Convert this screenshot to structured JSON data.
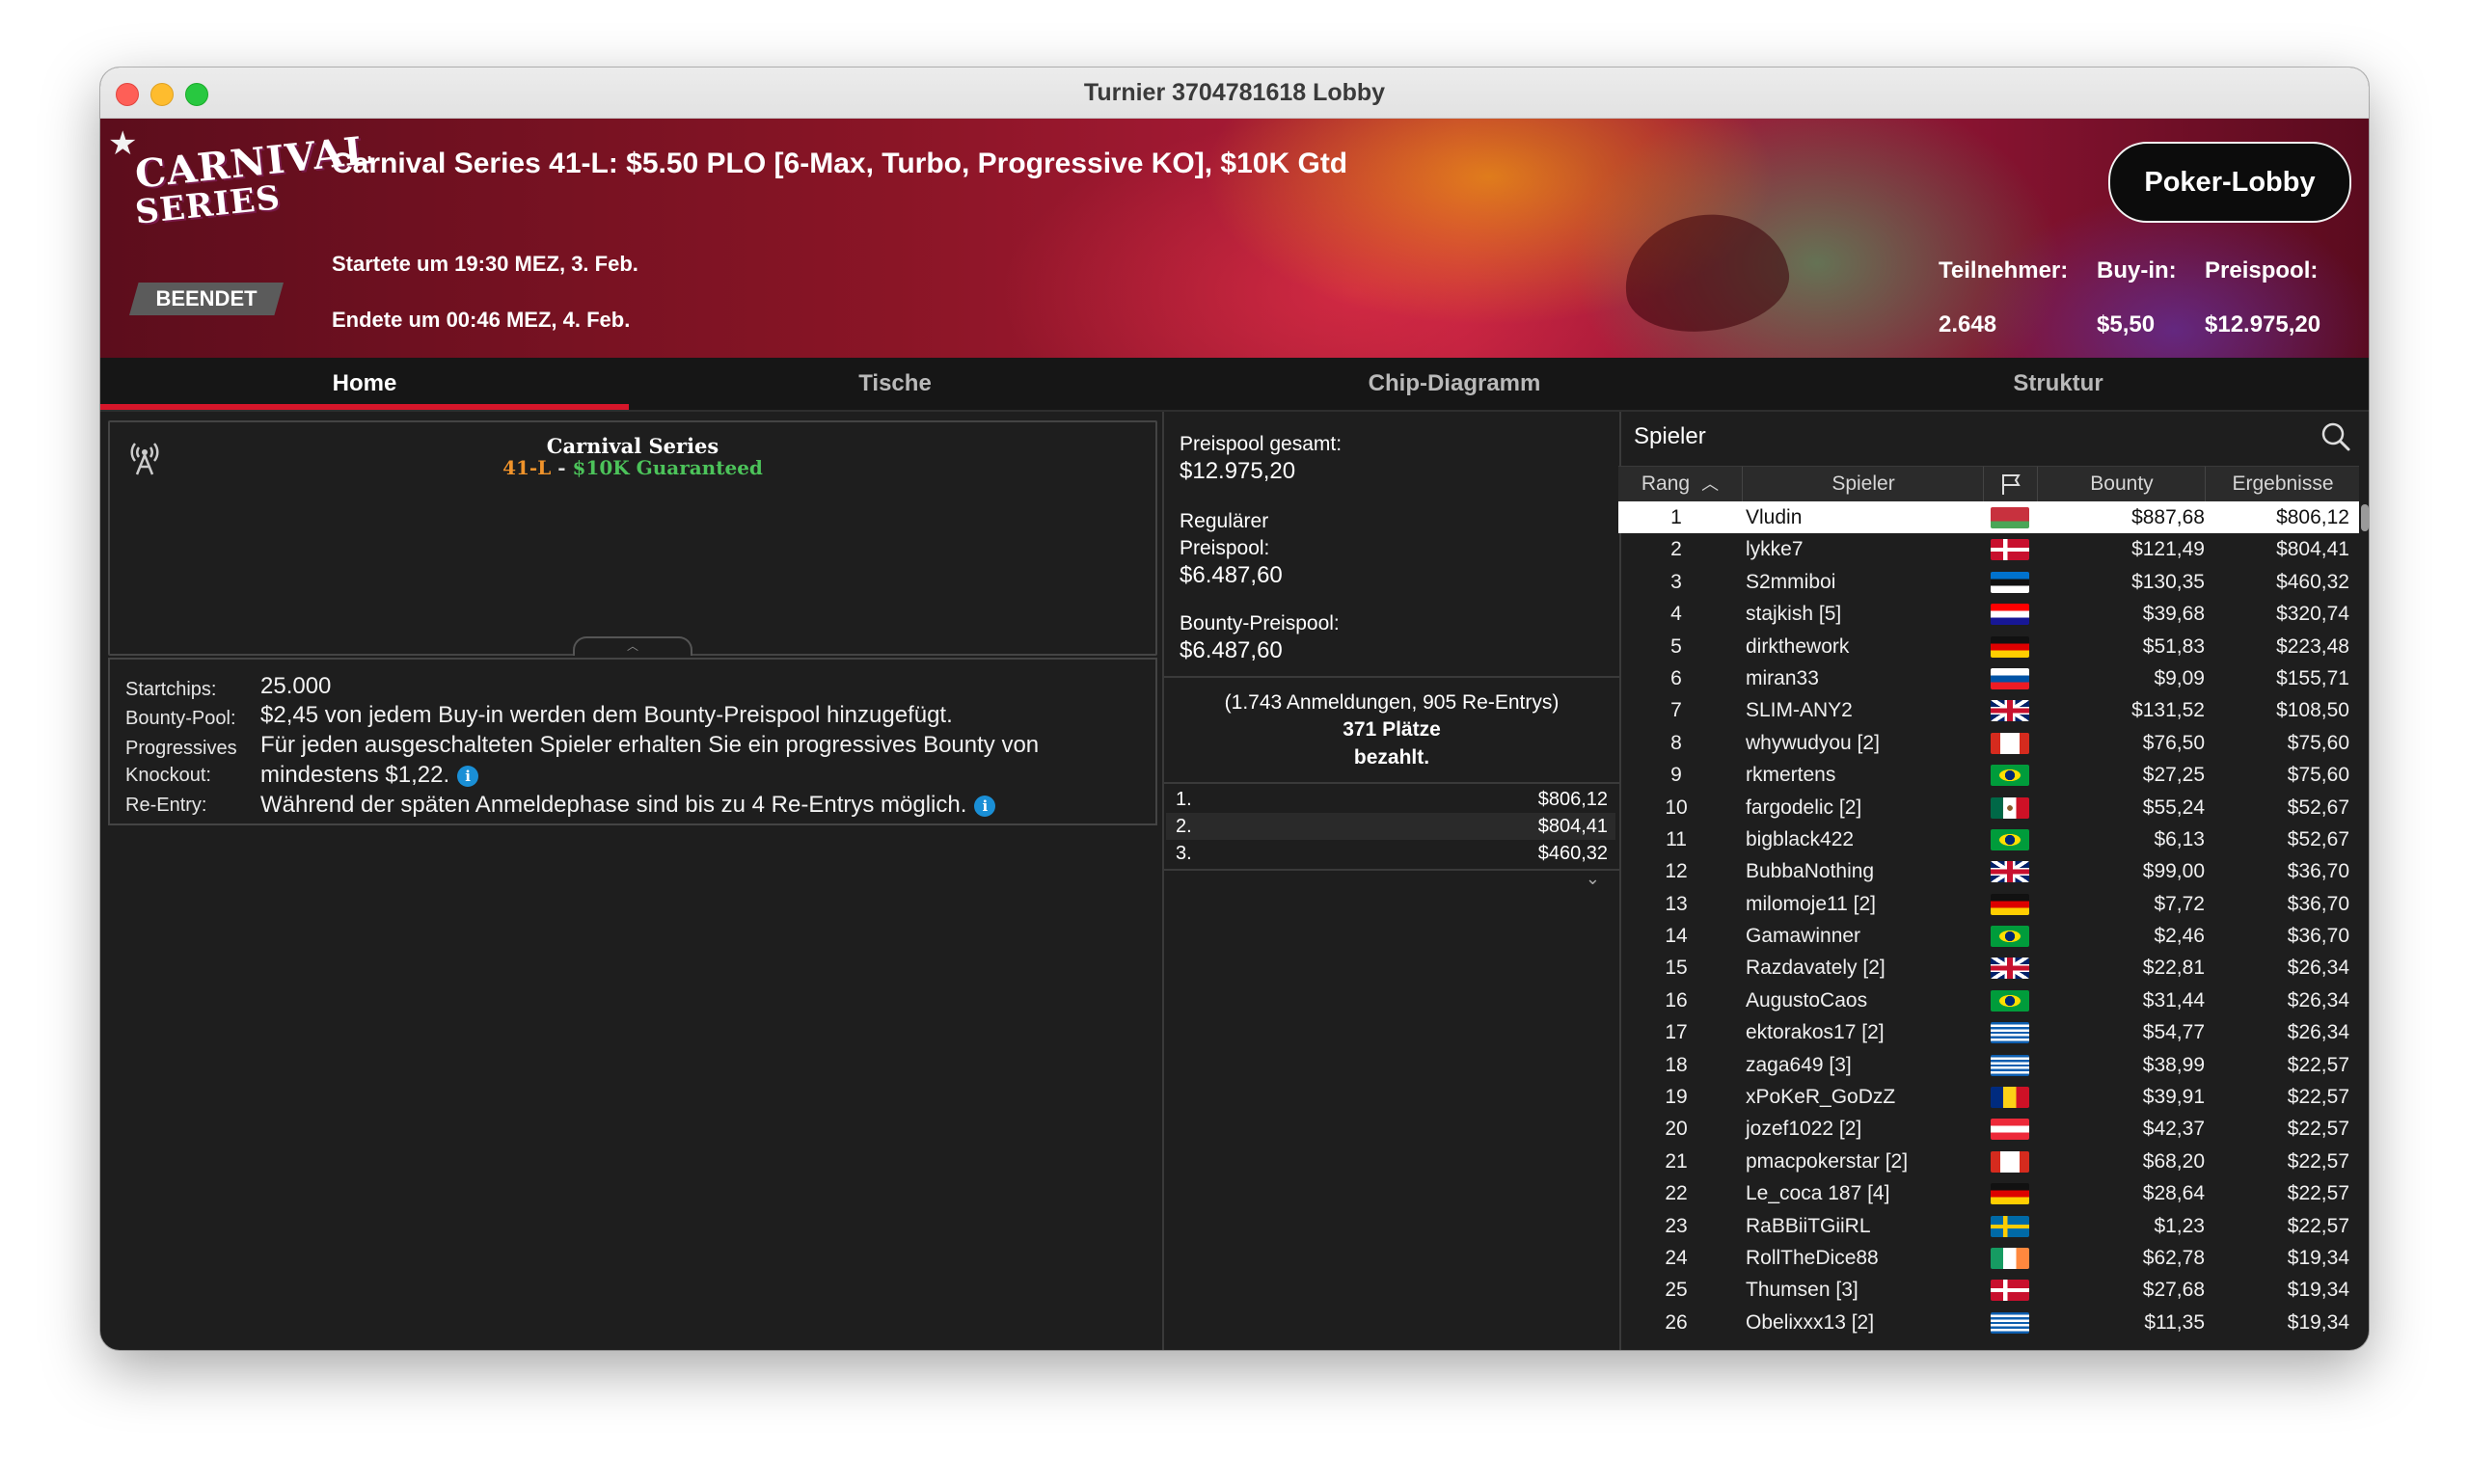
{
  "window": {
    "title": "Turnier 3704781618 Lobby"
  },
  "banner": {
    "logo_line1": "CARNIVAL",
    "logo_line2": "SERIES",
    "status": "BEENDET",
    "title": "Carnival Series 41-L: $5.50 PLO [6-Max, Turbo, Progressive KO], $10K Gtd",
    "started": "Startete um 19:30 MEZ, 3. Feb.",
    "ended": "Endete um 00:46 MEZ, 4. Feb.",
    "lobby_button": "Poker-Lobby",
    "stats": [
      {
        "label": "Teilnehmer:",
        "value": "2.648"
      },
      {
        "label": "Buy-in:",
        "value": "$5,50"
      },
      {
        "label": "Preispool:",
        "value": "$12.975,20"
      }
    ]
  },
  "tabs": [
    {
      "label": "Home",
      "active": true
    },
    {
      "label": "Tische",
      "active": false
    },
    {
      "label": "Chip-Diagramm",
      "active": false
    },
    {
      "label": "Struktur",
      "active": false
    }
  ],
  "home": {
    "promo_title": "Carnival Series",
    "promo_sub_a": "41-L",
    "promo_sub_sep": " - ",
    "promo_sub_b": "$10K Guaranteed",
    "info": {
      "startchips_label": "Startchips:",
      "startchips_value": "25.000",
      "bounty_label": "Bounty-Pool:",
      "bounty_value": "$2,45 von jedem Buy-in werden dem Bounty-Preispool hinzugefügt.",
      "pko_label_1": "Progressives",
      "pko_label_2": "Knockout:",
      "pko_value_1": "Für jeden ausgeschalteten Spieler erhalten Sie ein progressives Bounty von",
      "pko_value_2": "mindestens $1,22.",
      "reentry_label": "Re-Entry:",
      "reentry_value": "Während der späten Anmeldephase sind bis zu 4 Re-Entrys möglich."
    }
  },
  "prize": {
    "total_label": "Preispool gesamt:",
    "total_value": "$12.975,20",
    "regular_label_1": "Regulärer",
    "regular_label_2": "Preispool:",
    "regular_value": "$6.487,60",
    "bounty_label": "Bounty-Preispool:",
    "bounty_value": "$6.487,60",
    "entries": "(1.743 Anmeldungen, 905 Re-Entrys)",
    "places": "371 Plätze",
    "paid": "bezahlt.",
    "payouts": [
      {
        "place": "1.",
        "amount": "$806,12"
      },
      {
        "place": "2.",
        "amount": "$804,41"
      },
      {
        "place": "3.",
        "amount": "$460,32"
      }
    ]
  },
  "players": {
    "title": "Spieler",
    "columns": {
      "rank": "Rang",
      "player": "Spieler",
      "bounty": "Bounty",
      "results": "Ergebnisse"
    },
    "rows": [
      {
        "rank": "1",
        "name": "Vludin",
        "flag": "belarus-flag",
        "bounty": "$887,68",
        "result": "$806,12"
      },
      {
        "rank": "2",
        "name": "lykke7",
        "flag": "denmark-flag",
        "bounty": "$121,49",
        "result": "$804,41"
      },
      {
        "rank": "3",
        "name": "S2mmiboi",
        "flag": "estonia-flag",
        "bounty": "$130,35",
        "result": "$460,32"
      },
      {
        "rank": "4",
        "name": "stajkish [5]",
        "flag": "croatia-flag",
        "bounty": "$39,68",
        "result": "$320,74"
      },
      {
        "rank": "5",
        "name": "dirkthework",
        "flag": "germany-flag",
        "bounty": "$51,83",
        "result": "$223,48"
      },
      {
        "rank": "6",
        "name": "miran33",
        "flag": "slovenia-flag",
        "bounty": "$9,09",
        "result": "$155,71"
      },
      {
        "rank": "7",
        "name": "SLIM-ANY2",
        "flag": "uk-flag",
        "bounty": "$131,52",
        "result": "$108,50"
      },
      {
        "rank": "8",
        "name": "whywudyou [2]",
        "flag": "canada-flag",
        "bounty": "$76,50",
        "result": "$75,60"
      },
      {
        "rank": "9",
        "name": "rkmertens",
        "flag": "brazil-flag",
        "bounty": "$27,25",
        "result": "$75,60"
      },
      {
        "rank": "10",
        "name": "fargodelic [2]",
        "flag": "mexico-flag",
        "bounty": "$55,24",
        "result": "$52,67"
      },
      {
        "rank": "11",
        "name": "bigblack422",
        "flag": "brazil-flag",
        "bounty": "$6,13",
        "result": "$52,67"
      },
      {
        "rank": "12",
        "name": "BubbaNothing",
        "flag": "uk-flag",
        "bounty": "$99,00",
        "result": "$36,70"
      },
      {
        "rank": "13",
        "name": "milomoje11 [2]",
        "flag": "germany-flag",
        "bounty": "$7,72",
        "result": "$36,70"
      },
      {
        "rank": "14",
        "name": "Gamawinner",
        "flag": "brazil-flag",
        "bounty": "$2,46",
        "result": "$36,70"
      },
      {
        "rank": "15",
        "name": "Razdavately [2]",
        "flag": "uk-flag",
        "bounty": "$22,81",
        "result": "$26,34"
      },
      {
        "rank": "16",
        "name": "AugustoCaos",
        "flag": "brazil-flag",
        "bounty": "$31,44",
        "result": "$26,34"
      },
      {
        "rank": "17",
        "name": "ektorakos17 [2]",
        "flag": "greece-flag",
        "bounty": "$54,77",
        "result": "$26,34"
      },
      {
        "rank": "18",
        "name": "zaga649 [3]",
        "flag": "greece-flag",
        "bounty": "$38,99",
        "result": "$22,57"
      },
      {
        "rank": "19",
        "name": "xPoKeR_GoDzZ",
        "flag": "romania-flag",
        "bounty": "$39,91",
        "result": "$22,57"
      },
      {
        "rank": "20",
        "name": "jozef1022 [2]",
        "flag": "austria-flag",
        "bounty": "$42,37",
        "result": "$22,57"
      },
      {
        "rank": "21",
        "name": "pmacpokerstar [2]",
        "flag": "canada-flag",
        "bounty": "$68,20",
        "result": "$22,57"
      },
      {
        "rank": "22",
        "name": "Le_coca 187 [4]",
        "flag": "germany-flag",
        "bounty": "$28,64",
        "result": "$22,57"
      },
      {
        "rank": "23",
        "name": "RaBBiiTGiiRL",
        "flag": "sweden-flag",
        "bounty": "$1,23",
        "result": "$22,57"
      },
      {
        "rank": "24",
        "name": "RollTheDice88",
        "flag": "ireland-flag",
        "bounty": "$62,78",
        "result": "$19,34"
      },
      {
        "rank": "25",
        "name": "Thumsen [3]",
        "flag": "denmark-flag",
        "bounty": "$27,68",
        "result": "$19,34"
      },
      {
        "rank": "26",
        "name": "Obelixxx13 [2]",
        "flag": "greece-flag",
        "bounty": "$11,35",
        "result": "$19,34"
      }
    ]
  }
}
